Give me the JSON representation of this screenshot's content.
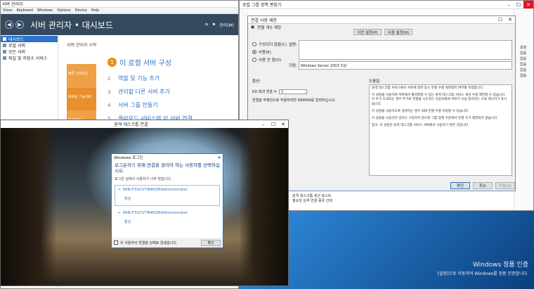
{
  "server_manager": {
    "window_title": "서버 관리자",
    "menu": [
      "Vizoo",
      "Keyboard",
      "Windows",
      "Options",
      "Device",
      "Help"
    ],
    "header_title": "서버 관리자 • 대시보드",
    "header_manage": "관리(M)",
    "sidebar": [
      {
        "label": "대시보드",
        "active": true
      },
      {
        "label": "로컬 서버",
        "active": false
      },
      {
        "label": "모든 서버",
        "active": false
      },
      {
        "label": "파일 및 저장소 서비스",
        "active": false
      }
    ],
    "welcome_heading": "서버 관리자 시작",
    "quickstart_labels": [
      "빠른 시작(Q)",
      "새로운 기능(W)",
      "자세히(L)"
    ],
    "steps": [
      {
        "num": "1",
        "label": "이 로컬 서버 구성"
      },
      {
        "num": "2",
        "label": "역할 및 기능 추가"
      },
      {
        "num": "3",
        "label": "관리할 다른 서버 추가"
      },
      {
        "num": "4",
        "label": "서버 그룹 만들기"
      },
      {
        "num": "5",
        "label": "클라우드 서비스에 이 서버 연결"
      }
    ]
  },
  "group_policy": {
    "window_title": "로컬 그룹 정책 편집기",
    "right_items": [
      "설정",
      "없음",
      "없음",
      "없음",
      "없음",
      "없음"
    ],
    "strip_items": [
      "원격 데스크톱 세션 호스트",
      "필요한 원격 연결 종류 선택"
    ]
  },
  "settings_dialog": {
    "title": "연결 사용 제한",
    "subtitle": "연결 개수 제한",
    "prev_button": "이전 설정(P)",
    "next_button": "다음 설정(N)",
    "comment_label": "설명:",
    "radio_not_configured": "구성되지 않음(C)",
    "radio_enabled": "사용(E)",
    "radio_disabled": "사용 안 함(D)",
    "supported_label": "지원:",
    "supported_value": "Windows Server 2003 이상",
    "options_label": "옵션:",
    "help_label": "도움말:",
    "option_field_label": "RD 최대 연결 수",
    "option_field_value": "1",
    "option_note": "연결을 무제한으로 허용하려면 999999를 입력하십시오.",
    "help_paragraphs": [
      "원격 데스크톱 서비스에서 서버에 대한 동시 연결 수를 제한할지 여부를 지정합니다.",
      "이 설정을 사용하여 서버에서 활성화할 수 있는 원격 데스크톱 서비스 세션 수를 제한할 수 있습니다. 이 수가 초과되는 경우 추가로 연결을 시도하는 사용자에게 서버가 사용 중이라는 오류 메시지가 표시됩니다.",
      "이 설정을 사용하도록 설정하는 경우 최대 연결 수를 지정할 수 있습니다.",
      "이 설정을 사용하지 않거나 구성하지 않으면 그룹 정책 수준에서 연결 수가 제한되지 않습니다.",
      "참고: 이 설정은 원격 데스크톱 서비스 서버에서 사용하기 위한 것입니다."
    ],
    "ok_button": "확인",
    "cancel_button": "취소",
    "apply_button": "적용(A)"
  },
  "remote_desktop": {
    "window_title": "원격 데스크톱 연결"
  },
  "login_dialog": {
    "title": "Windows 로그인",
    "question": "로그온하기 위해 연결을 끊어야 하는 사용자를 선택하십시오.",
    "note": "로그온 상태의 사용자가 너무 많습니다.",
    "accounts": [
      {
        "name": "WIN-F3UCV7B4R28\\Administrator",
        "status": "활성"
      },
      {
        "name": "WIN-F3UCV7B4R28\\Administrator",
        "status": "활성"
      }
    ],
    "force_checkbox": "이 사용자의 연결을 강제로 끊겠습니다.",
    "ok_button": "확인"
  },
  "desktop": {
    "watermark_title": "Windows 정품 인증",
    "watermark_sub": "[설정]으로 이동하여 Windows를 정품 인증합니다."
  }
}
